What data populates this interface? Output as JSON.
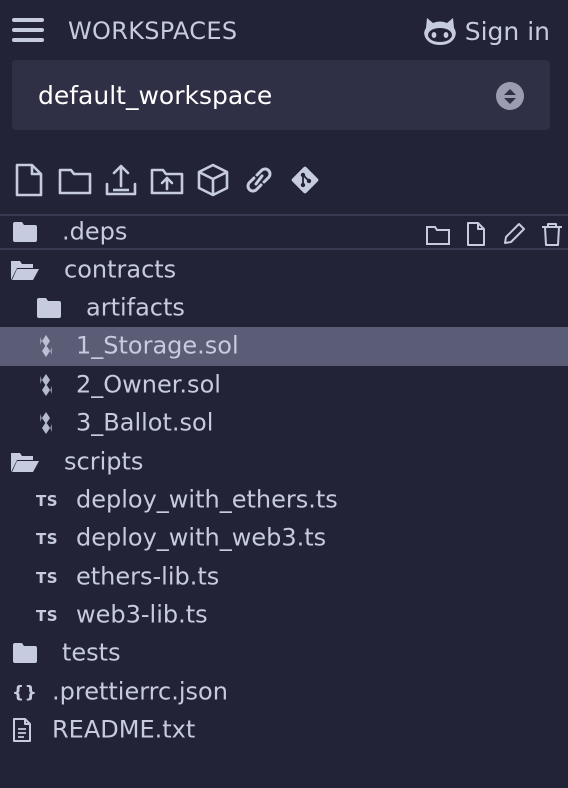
{
  "header": {
    "title": "WORKSPACES",
    "signin_label": "Sign in"
  },
  "workspace": {
    "selected": "default_workspace"
  },
  "toolbar": {
    "icons": [
      "new-file-icon",
      "new-folder-icon",
      "publish-gist-icon",
      "upload-file-icon",
      "ipfs-icon",
      "link-icon",
      "git-icon"
    ]
  },
  "tree": {
    "items": [
      {
        "label": ".deps",
        "type": "folder"
      },
      {
        "label": "contracts",
        "type": "folder-open"
      },
      {
        "label": "artifacts",
        "type": "folder"
      },
      {
        "label": "1_Storage.sol",
        "type": "sol"
      },
      {
        "label": "2_Owner.sol",
        "type": "sol"
      },
      {
        "label": "3_Ballot.sol",
        "type": "sol"
      },
      {
        "label": "scripts",
        "type": "folder-open"
      },
      {
        "label": "deploy_with_ethers.ts",
        "type": "ts",
        "badge": "TS"
      },
      {
        "label": "deploy_with_web3.ts",
        "type": "ts",
        "badge": "TS"
      },
      {
        "label": "ethers-lib.ts",
        "type": "ts",
        "badge": "TS"
      },
      {
        "label": "web3-lib.ts",
        "type": "ts",
        "badge": "TS"
      },
      {
        "label": "tests",
        "type": "folder"
      },
      {
        "label": ".prettierrc.json",
        "type": "json",
        "badge": "{}"
      },
      {
        "label": "README.txt",
        "type": "txt"
      }
    ]
  },
  "colors": {
    "background": "#222336",
    "text": "#c6cbe0",
    "select_bg": "#2f3045",
    "selected_row": "#5b5d76"
  }
}
